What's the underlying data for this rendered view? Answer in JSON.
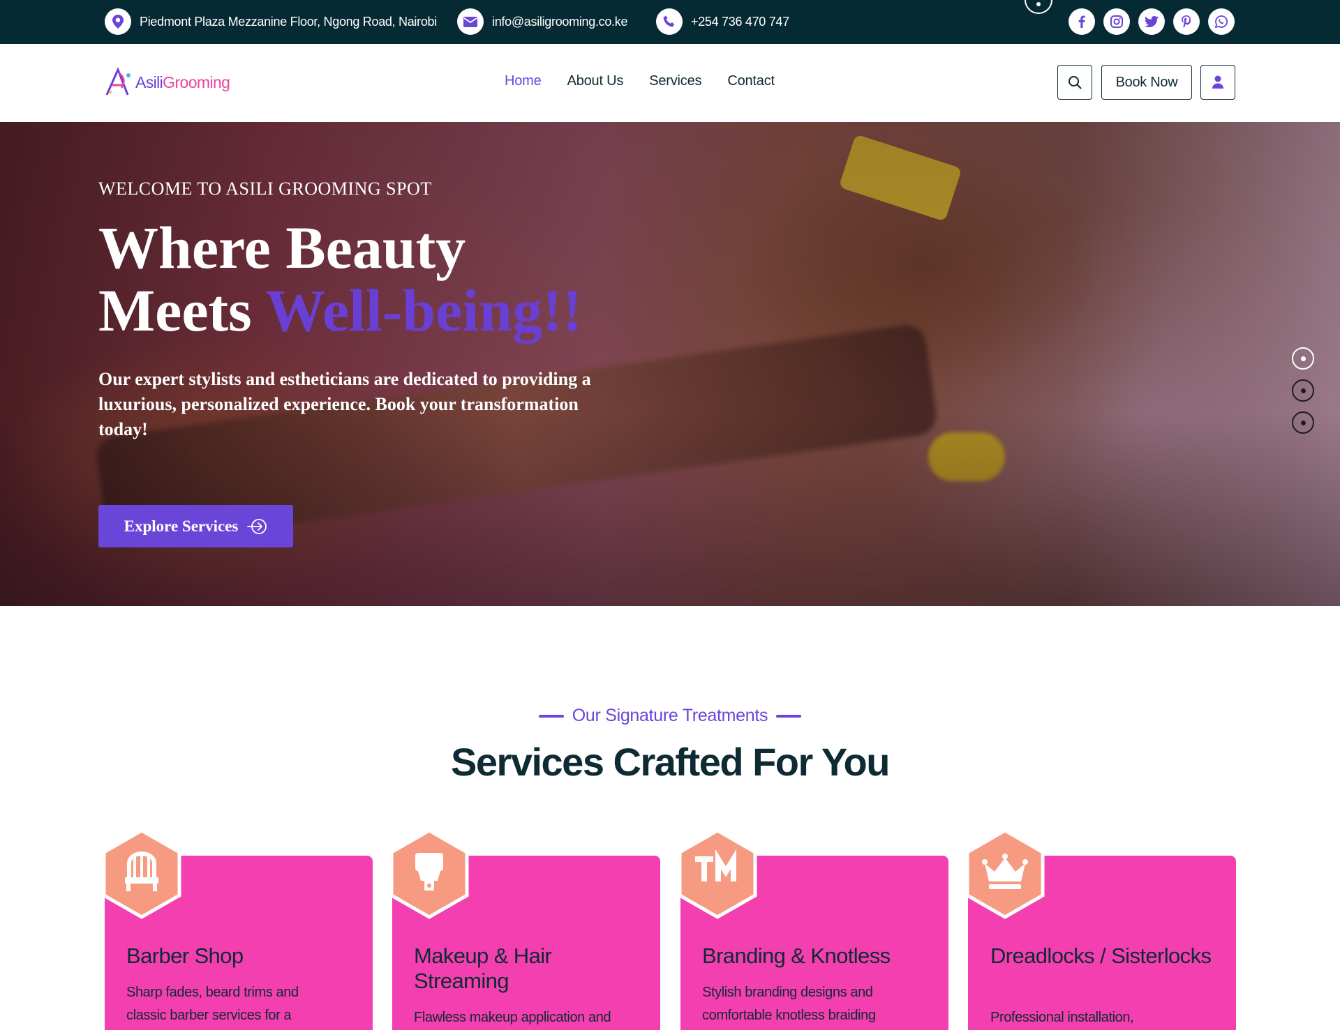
{
  "topbar": {
    "address": "Piedmont Plaza Mezzanine Floor, Ngong Road, Nairobi",
    "email": "info@asiligrooming.co.ke",
    "phone": "+254 736 470 747",
    "social_icons": [
      "facebook-icon",
      "instagram-icon",
      "twitter-icon",
      "pinterest-icon",
      "whatsapp-icon"
    ]
  },
  "header": {
    "logo_part1": "Asili",
    "logo_part2": "Grooming",
    "nav": [
      "Home",
      "About Us",
      "Services",
      "Contact"
    ],
    "book_label": "Book Now"
  },
  "hero": {
    "kicker": "WELCOME TO ASILI GROOMING SPOT",
    "title_line1": "Where Beauty",
    "title_line2_plain": "Meets ",
    "title_line2_accent": "Well-being!!",
    "description": "Our expert stylists and estheticians are dedicated to providing a luxurious, personalized experience. Book your transformation today!",
    "cta_label": "Explore Services",
    "slides": 3,
    "active_slide": 1
  },
  "services": {
    "kicker": "Our Signature Treatments",
    "title": "Services Crafted For You",
    "items": [
      {
        "title": "Barber Shop",
        "desc_lines": [
          "Sharp fades, beard trims and",
          "classic barber services for a"
        ],
        "icon": "barber-chair-icon"
      },
      {
        "title": "Makeup & Hair Streaming",
        "desc_lines": [
          "Flawless makeup application and"
        ],
        "icon": "makeup-brush-icon"
      },
      {
        "title": "Branding & Knotless",
        "desc_lines": [
          "Stylish branding designs and",
          "comfortable knotless braiding"
        ],
        "icon": "trademark-icon"
      },
      {
        "title": "Dreadlocks / Sisterlocks",
        "desc_lines": [
          "Professional installation,"
        ],
        "icon": "crown-icon"
      }
    ]
  },
  "colors": {
    "topbar_bg": "#062a33",
    "accent_purple": "#6a46d8",
    "card_pink": "#f43fb0",
    "hex_peach": "#f79a82"
  }
}
